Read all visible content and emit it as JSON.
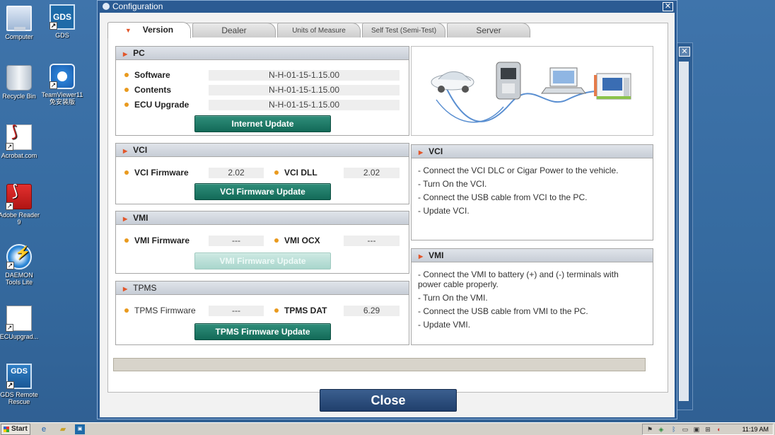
{
  "desktop": {
    "icons": [
      {
        "label": "Computer"
      },
      {
        "label": "GDS",
        "glyph": "GDS"
      },
      {
        "label": "Recycle Bin"
      },
      {
        "label": "TeamViewer11 免安装版"
      },
      {
        "label": "Acrobat.com"
      },
      {
        "label": "Adobe Reader 9"
      },
      {
        "label": "DAEMON Tools Lite"
      },
      {
        "label": "ECUupgrad..."
      },
      {
        "label": "GDS Remote Rescue",
        "glyph": "GDS"
      }
    ]
  },
  "window": {
    "title": "Configuration",
    "close_glyph": "✕"
  },
  "tabs": [
    {
      "label": "Version",
      "active": true
    },
    {
      "label": "Dealer"
    },
    {
      "label": "Units of Measure"
    },
    {
      "label": "Self Test (Semi-Test)"
    },
    {
      "label": "Server"
    }
  ],
  "pc": {
    "title": "PC",
    "rows": [
      {
        "label": "Software",
        "value": "N-H-01-15-1.15.00"
      },
      {
        "label": "Contents",
        "value": "N-H-01-15-1.15.00"
      },
      {
        "label": "ECU Upgrade",
        "value": "N-H-01-15-1.15.00"
      }
    ],
    "button": "Internet Update"
  },
  "vci": {
    "title": "VCI",
    "firmware_label": "VCI Firmware",
    "firmware_value": "2.02",
    "dll_label": "VCI DLL",
    "dll_value": "2.02",
    "button": "VCI Firmware Update"
  },
  "vmi": {
    "title": "VMI",
    "firmware_label": "VMI Firmware",
    "firmware_value": "---",
    "ocx_label": "VMI OCX",
    "ocx_value": "---",
    "button": "VMI Firmware Update"
  },
  "tpms": {
    "title": "TPMS",
    "firmware_label": "TPMS Firmware",
    "firmware_value": "---",
    "dat_label": "TPMS DAT",
    "dat_value": "6.29",
    "button": "TPMS Firmware Update"
  },
  "vci_info": {
    "title": "VCI",
    "lines": [
      "- Connect the VCI DLC or Cigar Power to the vehicle.",
      "- Turn On the VCI.",
      "- Connect the USB cable from VCI to the PC.",
      "- Update VCI."
    ]
  },
  "vmi_info": {
    "title": "VMI",
    "lines": [
      "- Connect the VMI to battery (+) and (-) terminals with",
      "power cable properly.",
      "- Turn On the VMI.",
      "- Connect the USB cable from VMI to the PC.",
      "- Update VMI."
    ]
  },
  "progress": {
    "value": 0
  },
  "close_button": "Close",
  "taskbar": {
    "start_label": "Start",
    "clock": "11:19 AM"
  },
  "colors": {
    "desktop": "#3a6ea5",
    "button_green": "#1e7a66",
    "close_navy": "#2b4d7c",
    "accent_orange": "#e2562a",
    "bullet": "#e99a1e"
  }
}
